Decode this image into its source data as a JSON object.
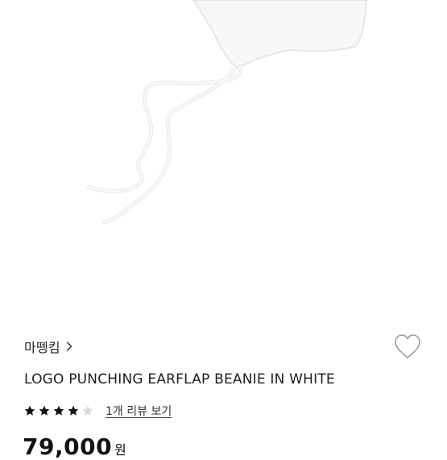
{
  "product": {
    "brand": "마뗑킴",
    "title": "LOGO PUNCHING EARFLAP BEANIE IN WHITE",
    "rating": {
      "value": 4,
      "max": 5
    },
    "review_link": "1개 리뷰 보기",
    "price": "79,000",
    "price_unit": "원"
  },
  "icons": {
    "brand_chevron": "chevron-right-icon",
    "wishlist": "heart-outline-icon",
    "star_filled": "star-filled-icon",
    "star_empty": "star-empty-icon"
  },
  "colors": {
    "text": "#1e1e1e",
    "star_filled": "#111111",
    "star_empty": "#d9d9d9",
    "heart_outline": "#999999"
  }
}
